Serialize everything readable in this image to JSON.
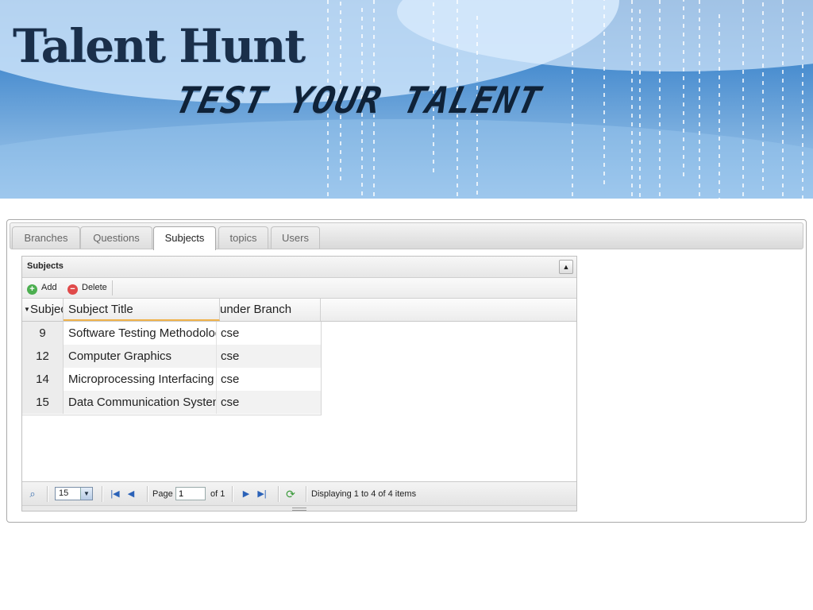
{
  "banner": {
    "title": "Talent Hunt",
    "tagline": "TEST YOUR TALENT"
  },
  "tabs": [
    {
      "label": "Branches",
      "active": false
    },
    {
      "label": "Questions",
      "active": false
    },
    {
      "label": "Subjects",
      "active": true
    },
    {
      "label": "topics",
      "active": false
    },
    {
      "label": "Users",
      "active": false
    }
  ],
  "grid": {
    "title": "Subjects",
    "toolbar": {
      "add_label": "Add",
      "delete_label": "Delete"
    },
    "columns": [
      "Subject",
      "Subject Title",
      "under Branch"
    ],
    "rows": [
      {
        "id": "9",
        "title": "Software Testing Methodologies",
        "branch": "cse"
      },
      {
        "id": "12",
        "title": "Computer Graphics",
        "branch": "cse"
      },
      {
        "id": "14",
        "title": "Microprocessing Interfacing",
        "branch": "cse"
      },
      {
        "id": "15",
        "title": "Data Communication Systems",
        "branch": "cse"
      }
    ],
    "pager": {
      "rows_per_page": "15",
      "page_label": "Page",
      "page_value": "1",
      "of_label": "of 1",
      "status": "Displaying 1 to 4 of 4 items"
    }
  },
  "icons": {
    "search": "search-icon",
    "first": "first-page-icon",
    "prev": "prev-page-icon",
    "next": "next-page-icon",
    "last": "last-page-icon",
    "refresh": "refresh-icon",
    "add": "add-icon",
    "delete": "delete-icon",
    "collapse": "collapse-icon"
  },
  "colors": {
    "banner_blue": "#4c8fd0",
    "add_green": "#4caf50",
    "delete_red": "#e04a4a",
    "sort_orange": "#f0b24a",
    "nav_blue": "#2b62b8"
  }
}
